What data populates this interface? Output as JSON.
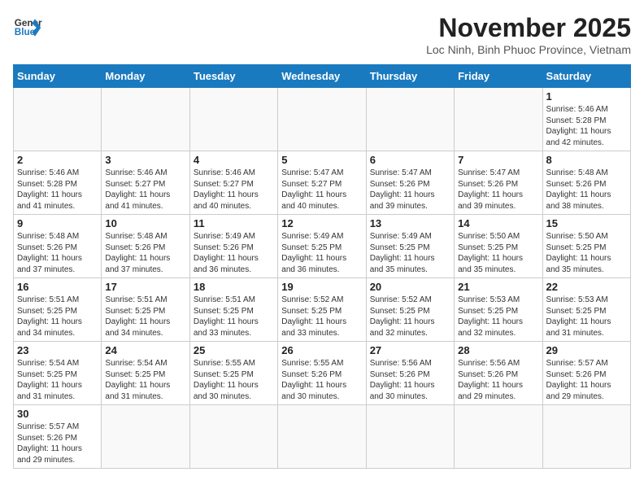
{
  "header": {
    "logo_line1": "General",
    "logo_line2": "Blue",
    "month": "November 2025",
    "location": "Loc Ninh, Binh Phuoc Province, Vietnam"
  },
  "days_of_week": [
    "Sunday",
    "Monday",
    "Tuesday",
    "Wednesday",
    "Thursday",
    "Friday",
    "Saturday"
  ],
  "weeks": [
    [
      {
        "day": "",
        "info": ""
      },
      {
        "day": "",
        "info": ""
      },
      {
        "day": "",
        "info": ""
      },
      {
        "day": "",
        "info": ""
      },
      {
        "day": "",
        "info": ""
      },
      {
        "day": "",
        "info": ""
      },
      {
        "day": "1",
        "info": "Sunrise: 5:46 AM\nSunset: 5:28 PM\nDaylight: 11 hours\nand 42 minutes."
      }
    ],
    [
      {
        "day": "2",
        "info": "Sunrise: 5:46 AM\nSunset: 5:28 PM\nDaylight: 11 hours\nand 41 minutes."
      },
      {
        "day": "3",
        "info": "Sunrise: 5:46 AM\nSunset: 5:27 PM\nDaylight: 11 hours\nand 41 minutes."
      },
      {
        "day": "4",
        "info": "Sunrise: 5:46 AM\nSunset: 5:27 PM\nDaylight: 11 hours\nand 40 minutes."
      },
      {
        "day": "5",
        "info": "Sunrise: 5:47 AM\nSunset: 5:27 PM\nDaylight: 11 hours\nand 40 minutes."
      },
      {
        "day": "6",
        "info": "Sunrise: 5:47 AM\nSunset: 5:26 PM\nDaylight: 11 hours\nand 39 minutes."
      },
      {
        "day": "7",
        "info": "Sunrise: 5:47 AM\nSunset: 5:26 PM\nDaylight: 11 hours\nand 39 minutes."
      },
      {
        "day": "8",
        "info": "Sunrise: 5:48 AM\nSunset: 5:26 PM\nDaylight: 11 hours\nand 38 minutes."
      }
    ],
    [
      {
        "day": "9",
        "info": "Sunrise: 5:48 AM\nSunset: 5:26 PM\nDaylight: 11 hours\nand 37 minutes."
      },
      {
        "day": "10",
        "info": "Sunrise: 5:48 AM\nSunset: 5:26 PM\nDaylight: 11 hours\nand 37 minutes."
      },
      {
        "day": "11",
        "info": "Sunrise: 5:49 AM\nSunset: 5:26 PM\nDaylight: 11 hours\nand 36 minutes."
      },
      {
        "day": "12",
        "info": "Sunrise: 5:49 AM\nSunset: 5:25 PM\nDaylight: 11 hours\nand 36 minutes."
      },
      {
        "day": "13",
        "info": "Sunrise: 5:49 AM\nSunset: 5:25 PM\nDaylight: 11 hours\nand 35 minutes."
      },
      {
        "day": "14",
        "info": "Sunrise: 5:50 AM\nSunset: 5:25 PM\nDaylight: 11 hours\nand 35 minutes."
      },
      {
        "day": "15",
        "info": "Sunrise: 5:50 AM\nSunset: 5:25 PM\nDaylight: 11 hours\nand 35 minutes."
      }
    ],
    [
      {
        "day": "16",
        "info": "Sunrise: 5:51 AM\nSunset: 5:25 PM\nDaylight: 11 hours\nand 34 minutes."
      },
      {
        "day": "17",
        "info": "Sunrise: 5:51 AM\nSunset: 5:25 PM\nDaylight: 11 hours\nand 34 minutes."
      },
      {
        "day": "18",
        "info": "Sunrise: 5:51 AM\nSunset: 5:25 PM\nDaylight: 11 hours\nand 33 minutes."
      },
      {
        "day": "19",
        "info": "Sunrise: 5:52 AM\nSunset: 5:25 PM\nDaylight: 11 hours\nand 33 minutes."
      },
      {
        "day": "20",
        "info": "Sunrise: 5:52 AM\nSunset: 5:25 PM\nDaylight: 11 hours\nand 32 minutes."
      },
      {
        "day": "21",
        "info": "Sunrise: 5:53 AM\nSunset: 5:25 PM\nDaylight: 11 hours\nand 32 minutes."
      },
      {
        "day": "22",
        "info": "Sunrise: 5:53 AM\nSunset: 5:25 PM\nDaylight: 11 hours\nand 31 minutes."
      }
    ],
    [
      {
        "day": "23",
        "info": "Sunrise: 5:54 AM\nSunset: 5:25 PM\nDaylight: 11 hours\nand 31 minutes."
      },
      {
        "day": "24",
        "info": "Sunrise: 5:54 AM\nSunset: 5:25 PM\nDaylight: 11 hours\nand 31 minutes."
      },
      {
        "day": "25",
        "info": "Sunrise: 5:55 AM\nSunset: 5:25 PM\nDaylight: 11 hours\nand 30 minutes."
      },
      {
        "day": "26",
        "info": "Sunrise: 5:55 AM\nSunset: 5:26 PM\nDaylight: 11 hours\nand 30 minutes."
      },
      {
        "day": "27",
        "info": "Sunrise: 5:56 AM\nSunset: 5:26 PM\nDaylight: 11 hours\nand 30 minutes."
      },
      {
        "day": "28",
        "info": "Sunrise: 5:56 AM\nSunset: 5:26 PM\nDaylight: 11 hours\nand 29 minutes."
      },
      {
        "day": "29",
        "info": "Sunrise: 5:57 AM\nSunset: 5:26 PM\nDaylight: 11 hours\nand 29 minutes."
      }
    ],
    [
      {
        "day": "30",
        "info": "Sunrise: 5:57 AM\nSunset: 5:26 PM\nDaylight: 11 hours\nand 29 minutes."
      },
      {
        "day": "",
        "info": ""
      },
      {
        "day": "",
        "info": ""
      },
      {
        "day": "",
        "info": ""
      },
      {
        "day": "",
        "info": ""
      },
      {
        "day": "",
        "info": ""
      },
      {
        "day": "",
        "info": ""
      }
    ]
  ]
}
